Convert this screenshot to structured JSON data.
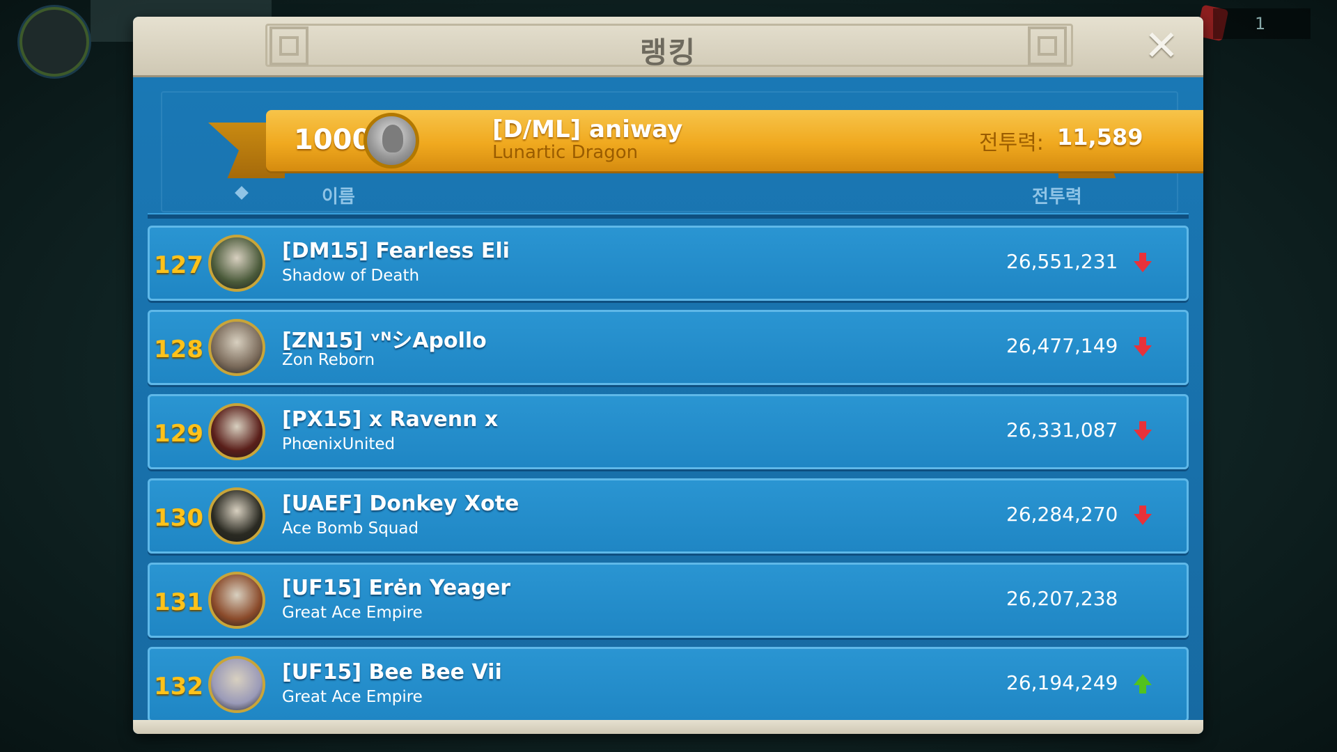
{
  "background": {
    "counter_text": "1"
  },
  "modal": {
    "title": "랭킹",
    "close_label": "✕"
  },
  "player": {
    "rank": "1000+",
    "name": "[D/ML] aniway",
    "guild": "Lunartic Dragon",
    "power_label": "전투력:",
    "power": "11,589"
  },
  "columns": {
    "name": "이름",
    "power": "전투력"
  },
  "rows": [
    {
      "rank": "127",
      "name": "[DM15] Fearless Eli",
      "guild": "Shadow of Death",
      "power": "26,551,231",
      "trend": "down",
      "avatar_color": "#4a5a3a"
    },
    {
      "rank": "128",
      "name": "[ZN15] ᵛᴺシApollo",
      "guild": "Zon Reborn",
      "power": "26,477,149",
      "trend": "down",
      "avatar_color": "#7a6a5a"
    },
    {
      "rank": "129",
      "name": "[PX15] x Ravenn x",
      "guild": "PhœnixUnited",
      "power": "26,331,087",
      "trend": "down",
      "avatar_color": "#5a1f1a"
    },
    {
      "rank": "130",
      "name": "[UAEF] Donkey Xote",
      "guild": "Ace Bomb Squad",
      "power": "26,284,270",
      "trend": "down",
      "avatar_color": "#2a2a22"
    },
    {
      "rank": "131",
      "name": "[UF15] Erėn Yeager",
      "guild": "Great Ace Empire",
      "power": "26,207,238",
      "trend": "none",
      "avatar_color": "#8a4a2a"
    },
    {
      "rank": "132",
      "name": "[UF15] Bee Bee Vii",
      "guild": "Great Ace Empire",
      "power": "26,194,249",
      "trend": "up",
      "avatar_color": "#9a9ab8"
    }
  ],
  "colors": {
    "panel": "#1a6fa8",
    "banner": "#f0a91f",
    "rank_text": "#ffc21a",
    "trend_down": "#e8323a",
    "trend_up": "#52c21e"
  }
}
